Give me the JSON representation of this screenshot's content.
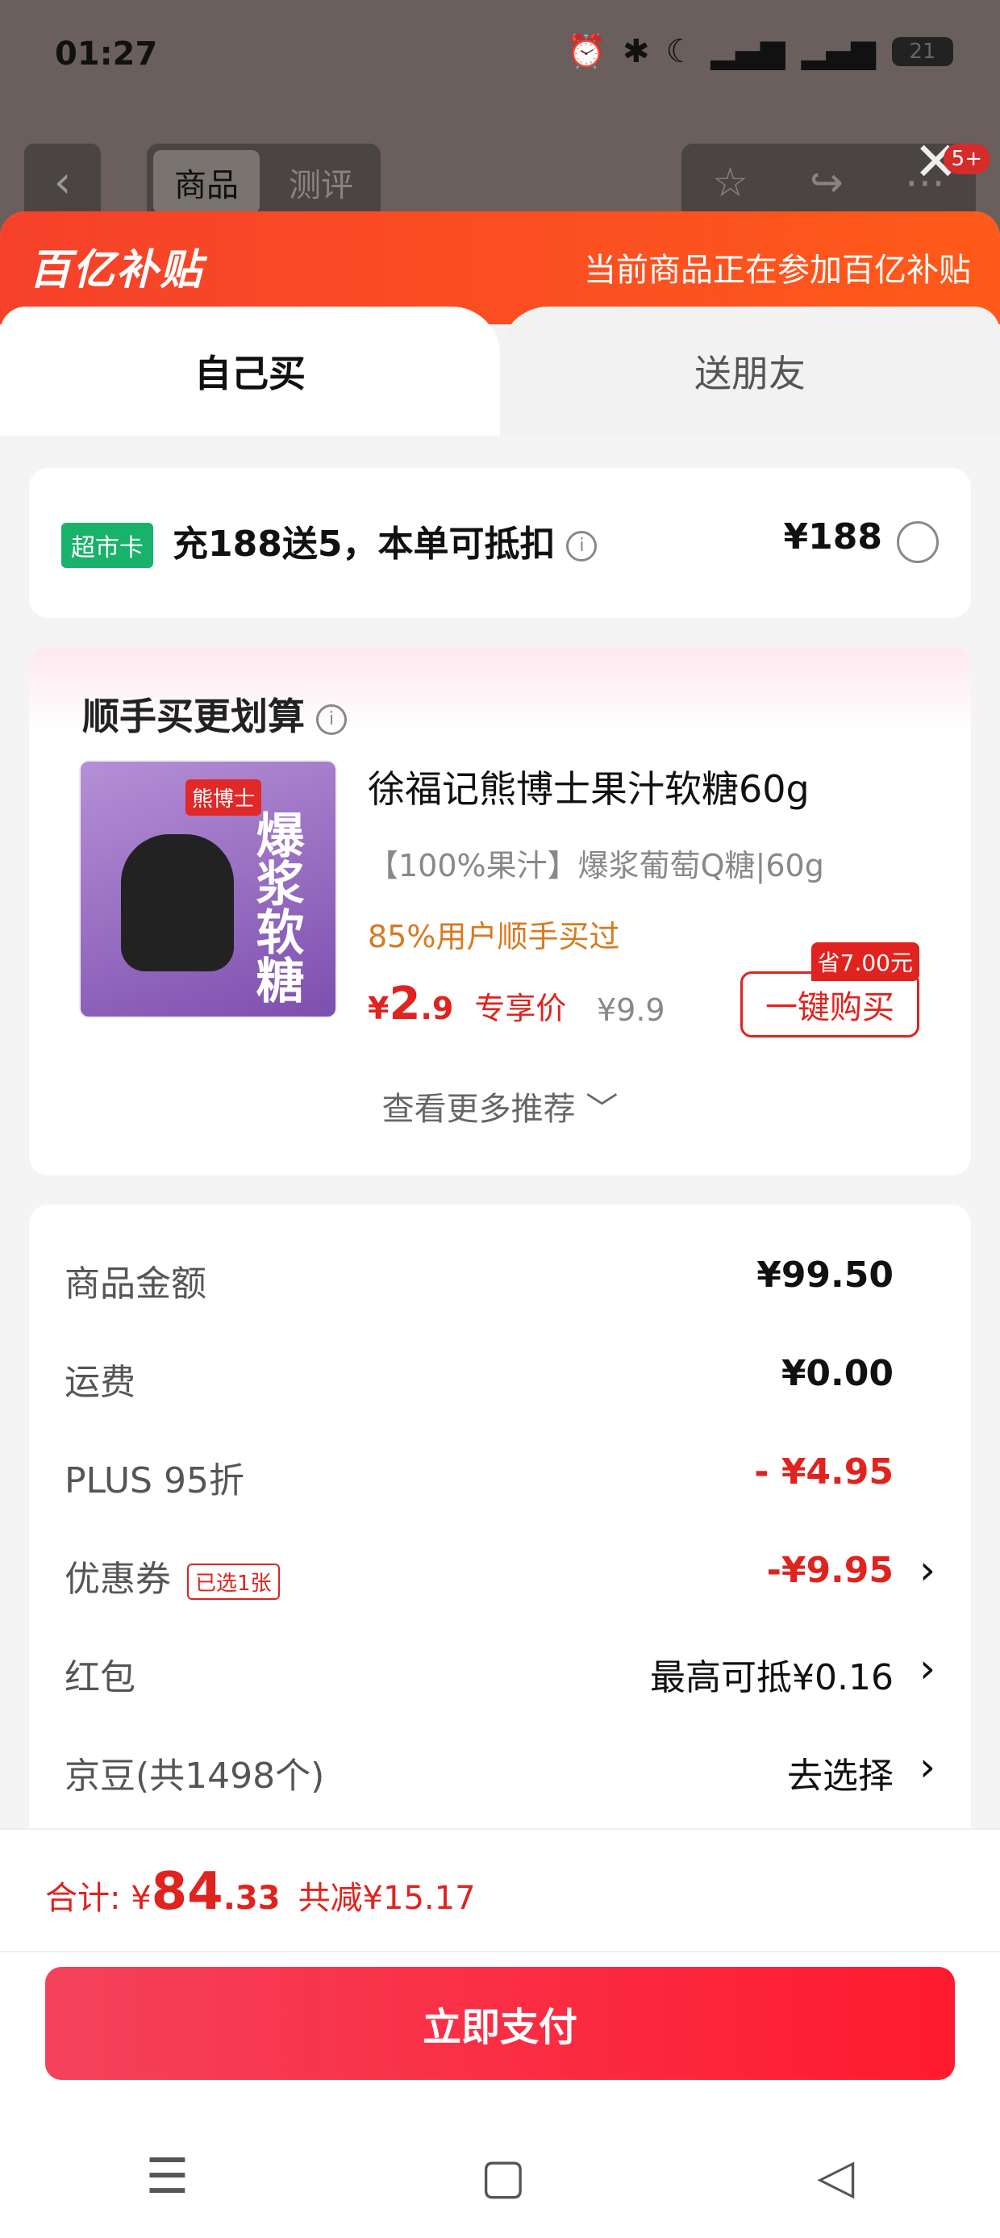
{
  "status_bar": {
    "time": "01:27",
    "battery": "21"
  },
  "background_nav": {
    "tabs": [
      {
        "label": "商品"
      },
      {
        "label": "测评"
      }
    ],
    "notification_badge": "5+"
  },
  "promo": {
    "logo": "百亿补贴",
    "text": "当前商品正在参加百亿补贴"
  },
  "tabs": {
    "self": "自己买",
    "gift": "送朋友"
  },
  "supermarket": {
    "chip": "超市卡",
    "title": "充188送5，本单可抵扣",
    "price": "¥188"
  },
  "recommend": {
    "title": "顺手买更划算",
    "product_name": "徐福记熊博士果汁软糖60g",
    "product_spec": "【100%果汁】爆浆葡萄Q糖|60g",
    "buyers": "85%用户顺手买过",
    "price_currency": "¥",
    "price_int": "2",
    "price_dec": ".9",
    "price_label": "专享价",
    "orig_price": "¥9.9",
    "save_tag": "省7.00元",
    "buy_button": "一键购买",
    "more": "查看更多推荐 ﹀",
    "img_brand": "熊博士",
    "img_text": "爆浆软糖"
  },
  "summary": {
    "rows": [
      {
        "label": "商品金额",
        "value": "¥99.50"
      },
      {
        "label": "运费",
        "value": "¥0.00"
      },
      {
        "label": "PLUS 95折",
        "value": "- ¥4.95"
      },
      {
        "label": "优惠券",
        "tag": "已选1张",
        "value": "-¥9.95"
      },
      {
        "label": "红包",
        "value": "最高可抵¥0.16"
      },
      {
        "label": "京豆(共1498个)",
        "value": "去选择"
      }
    ]
  },
  "footer": {
    "total_label": "合计: ¥",
    "total_int": "84",
    "total_dec": ".33",
    "saved": "共减¥15.17",
    "pay_button": "立即支付"
  }
}
